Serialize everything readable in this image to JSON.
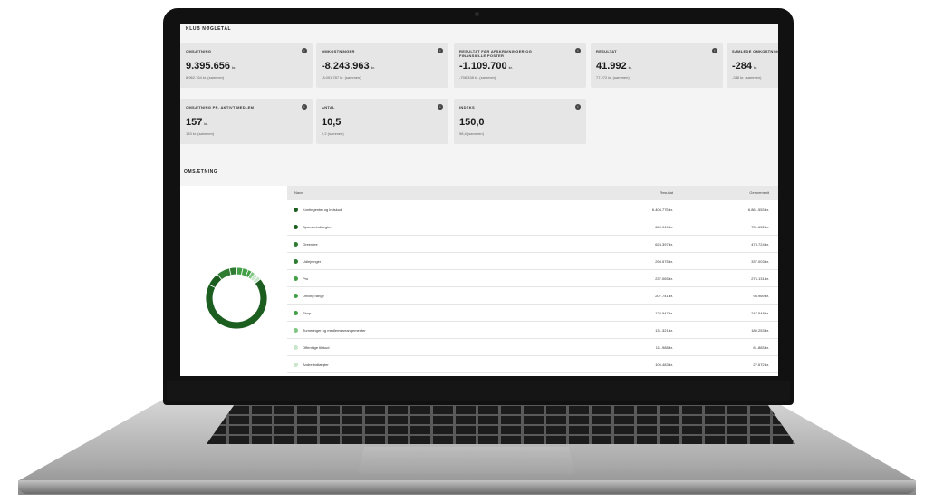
{
  "dashboard": {
    "kpi_section_title": "KLUB NØGLETAL",
    "kpis": [
      {
        "label": "OMSÆTNING",
        "value": "9.395.656",
        "unit": "kr.",
        "sub": "8.962.764 kr. (sammen)"
      },
      {
        "label": "OMKOSTNINGER",
        "value": "-8.243.963",
        "unit": "kr.",
        "sub": "-8.091.787 kr. (sammen)"
      },
      {
        "label": "RESULTAT FØR AFSKRIVNINGER OG FINANSIELLE POSTER",
        "value": "-1.109.700",
        "unit": "kr.",
        "sub": "-798.338 kr. (sammen)"
      },
      {
        "label": "RESULTAT",
        "value": "41.992",
        "unit": "kr.",
        "sub": "77.272 kr. (sammen)"
      },
      {
        "label": "SAMLEDE OMKOSTNINGER",
        "value": "-284",
        "unit": "kr.",
        "sub": "-318 kr. (sammen)"
      },
      {
        "label": "OMSÆTNING PR. AKTIVT MEDLEM",
        "value": "157",
        "unit": "kr.",
        "sub": "133 kr. (sammen)"
      },
      {
        "label": "ANTAL",
        "value": "10,5",
        "unit": "",
        "sub": "9,2 (sammen)"
      },
      {
        "label": "INDEKS",
        "value": "150,0",
        "unit": "",
        "sub": "98,4 (sammen)"
      }
    ],
    "revenue_section_title": "OMSÆTNING",
    "table": {
      "headers": {
        "name": "Navn",
        "col1": "Resultat",
        "col2": "Gennemsnit"
      },
      "rows": [
        {
          "name": "Kontingenter og indskud",
          "v1": "6.404.775 kr.",
          "v2": "6.861.553 kr."
        },
        {
          "name": "Sponsorindtægter",
          "v1": "669.949 kr.",
          "v2": "731.652 kr."
        },
        {
          "name": "Greenfee",
          "v1": "624.397 kr.",
          "v2": "473.724 kr."
        },
        {
          "name": "Udlejninger",
          "v1": "298.575 kr.",
          "v2": "337.003 kr."
        },
        {
          "name": "Pro",
          "v1": "237.065 kr.",
          "v2": "276.131 kr."
        },
        {
          "name": "Driving range",
          "v1": "207.741 kr.",
          "v2": "98.969 kr."
        },
        {
          "name": "Shop",
          "v1": "128.947 kr.",
          "v2": "247.548 kr."
        },
        {
          "name": "Turneringer og medlemsarrangementer",
          "v1": "131.321 kr.",
          "v2": "180.253 kr."
        },
        {
          "name": "Offentlige tilskud",
          "v1": "111.988 kr.",
          "v2": "81.883 kr."
        },
        {
          "name": "Andre indtægter",
          "v1": "106.483 kr.",
          "v2": "27.672 kr."
        }
      ]
    },
    "donut_shares": [
      0.68,
      0.07,
      0.07,
      0.04,
      0.03,
      0.03,
      0.02,
      0.02,
      0.02,
      0.02
    ],
    "colors": {
      "dark_green": "#1b5e20",
      "green": "#2e7d32",
      "mid_green": "#43a047",
      "light_green": "#81c784",
      "pale_green": "#c8e6c9"
    }
  }
}
